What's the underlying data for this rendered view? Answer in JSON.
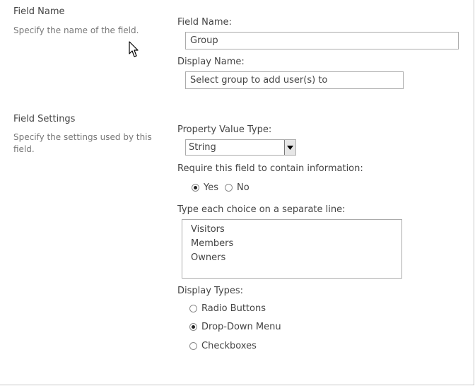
{
  "field_name_section": {
    "title": "Field Name",
    "description": "Specify the name of the field."
  },
  "field_settings_section": {
    "title": "Field Settings",
    "description_line1": "Specify the settings used by this",
    "description_line2": "field."
  },
  "field_name": {
    "label": "Field Name:",
    "value": "Group"
  },
  "display_name": {
    "label": "Display Name:",
    "value": "Select group to add user(s) to"
  },
  "property_value_type": {
    "label": "Property Value Type:",
    "selected": "String"
  },
  "require_field": {
    "label": "Require this field to contain information:",
    "options": [
      {
        "label": "Yes",
        "checked": true
      },
      {
        "label": "No",
        "checked": false
      }
    ]
  },
  "choices": {
    "label": "Type each choice on a separate line:",
    "items": [
      "Visitors",
      "Members",
      "Owners"
    ]
  },
  "display_types": {
    "label": "Display Types:",
    "options": [
      {
        "label": "Radio Buttons",
        "checked": false
      },
      {
        "label": "Drop-Down Menu",
        "checked": true
      },
      {
        "label": "Checkboxes",
        "checked": false
      }
    ]
  },
  "icons": {
    "cursor": "mouse-pointer-icon",
    "dropdown_arrow": "chevron-down-icon"
  }
}
